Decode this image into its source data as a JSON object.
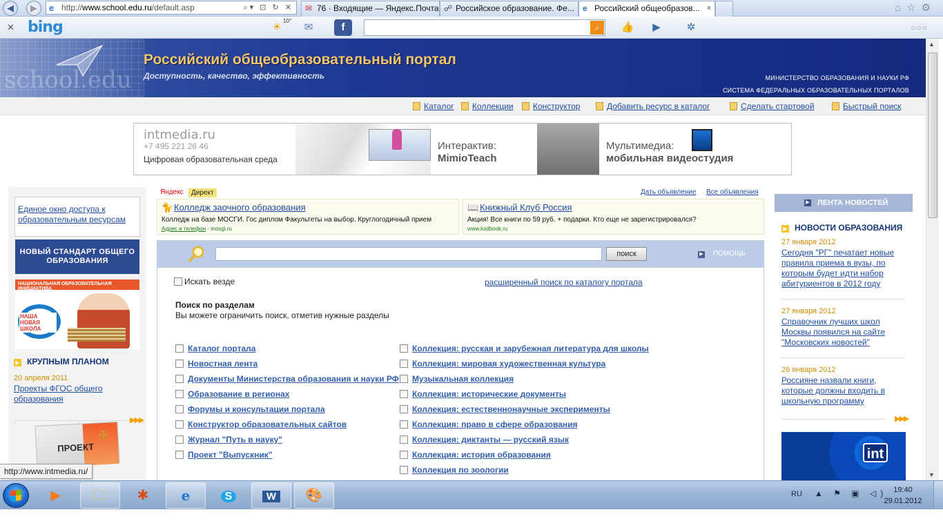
{
  "browser": {
    "address_protocol": "http://",
    "address_host": "www.school.edu.ru",
    "address_path": "/default.asp",
    "tabs": [
      {
        "label": "76 · Входящие — Яндекс.Почта"
      },
      {
        "label": "Российское образование. Фе..."
      },
      {
        "label": "Российский общеобразов...",
        "close": "×"
      }
    ],
    "bing": {
      "logo": "bing",
      "weather": "10°",
      "search_value": ""
    }
  },
  "portal": {
    "watermark": "school.edu",
    "title": "Российский общеобразовательный портал",
    "subtitle": "Доступность, качество, эффективность",
    "ministry": "МИНИСТЕРСТВО ОБРАЗОВАНИЯ И НАУКИ РФ",
    "system": "СИСТЕМА ФЕДЕРАЛЬНЫХ ОБРАЗОВАТЕЛЬНЫХ ПОРТАЛОВ",
    "menu": [
      {
        "label": "Каталог"
      },
      {
        "label": "Коллекции"
      },
      {
        "label": "Конструктор"
      },
      {
        "label": "Добавить ресурс в каталог"
      },
      {
        "label": "Сделать стартовой"
      },
      {
        "label": "Быстрый поиск"
      }
    ]
  },
  "ad_banner": {
    "logo": "intmedia.ru",
    "phone": "+7 495 221 26 46",
    "tagline": "Цифровая образовательная среда",
    "interactive_line1": "Интерактив:",
    "interactive_line2": "MimioTeach",
    "multimedia_line1": "Мультимедиа:",
    "multimedia_line2": "мобильная видеостудия"
  },
  "left": {
    "access_link": "Единое окно доступа к образовательным ресурсам",
    "standard_banner": "НОВЫЙ СТАНДАРТ ОБЩЕГО ОБРАЗОВАНИЯ",
    "nni_header": "НАЦИОНАЛЬНАЯ ОБРАЗОВАТЕЛЬНАЯ ИНИЦИАТИВА",
    "nni_logo": "НАША НОВАЯ ШКОЛА",
    "closeup_title": "КРУПНЫМ ПЛАНОМ",
    "closeup_date": "20 апреля 2011",
    "closeup_link": "Проекты ФГОС общего образования",
    "more": "▶▶▶",
    "project_label": "ПРОЕКТ"
  },
  "yandex_direct": {
    "yandex": "Яндекс",
    "direct": "Директ",
    "place_ad": "Дать объявление",
    "all_ads": "Все объявления",
    "ads": [
      {
        "title": "Колледж заочного образования",
        "desc": "Колледж на базе МОСГИ. Гос диплом Факультеты на выбор. Круглогодичный прием",
        "link1": "Адрес и телефон",
        "url": "mosgi.ru"
      },
      {
        "title": "Книжный Клуб Россия",
        "desc": "Акция! Все книги по 59 руб. + подарки. Кто еще не зарегистрировался?",
        "url": "www.ksdbook.ru"
      }
    ]
  },
  "search": {
    "query": "",
    "button": "поиск",
    "help": "ПОМОЩЬ",
    "everywhere": "Искать везде",
    "advanced": "расширенный поиск по каталогу портала",
    "sections_title": "Поиск по разделам",
    "sections_hint": "Вы можете ограничить поиск, отметив нужные разделы",
    "col1": [
      "Каталог портала",
      "Новостная лента",
      "Документы Министерства образования и науки РФ",
      "Образование в регионах",
      "Форумы и консультации портала",
      "Конструктор образовательных сайтов",
      "Журнал \"Путь в науку\"",
      "Проект \"Выпускник\""
    ],
    "col2": [
      "Коллекция: русская и зарубежная литература для школы",
      "Коллекция: мировая художественная культура",
      "Музыкальная коллекция",
      "Коллекция: исторические документы",
      "Коллекция: естественнонаучные эксперименты",
      "Коллекция: право в сфере образования",
      "Коллекция: диктанты — русский язык",
      "Коллекция: история образования",
      "Коллекция по зоологии"
    ]
  },
  "right": {
    "feed": "ЛЕНТА НОВОСТЕЙ",
    "news_title": "НОВОСТИ ОБРАЗОВАНИЯ",
    "news": [
      {
        "date": "27 января 2012",
        "text": "Сегодня \"РГ\" печатает новые правила приема в вузы, по которым будет идти набор абитуриентов в 2012 году"
      },
      {
        "date": "27 января 2012",
        "text": "Справочник лучших школ Москвы появился на сайте \"Московских новостей\""
      },
      {
        "date": "26 января 2012",
        "text": "Россияне назвали книги, которые должны входить в школьную программу"
      }
    ],
    "more": "▶▶▶",
    "int_logo": "int"
  },
  "status_tip": "http://www.intmedia.ru/",
  "taskbar": {
    "lang": "RU",
    "time": "19:40",
    "date": "29.01.2012"
  }
}
